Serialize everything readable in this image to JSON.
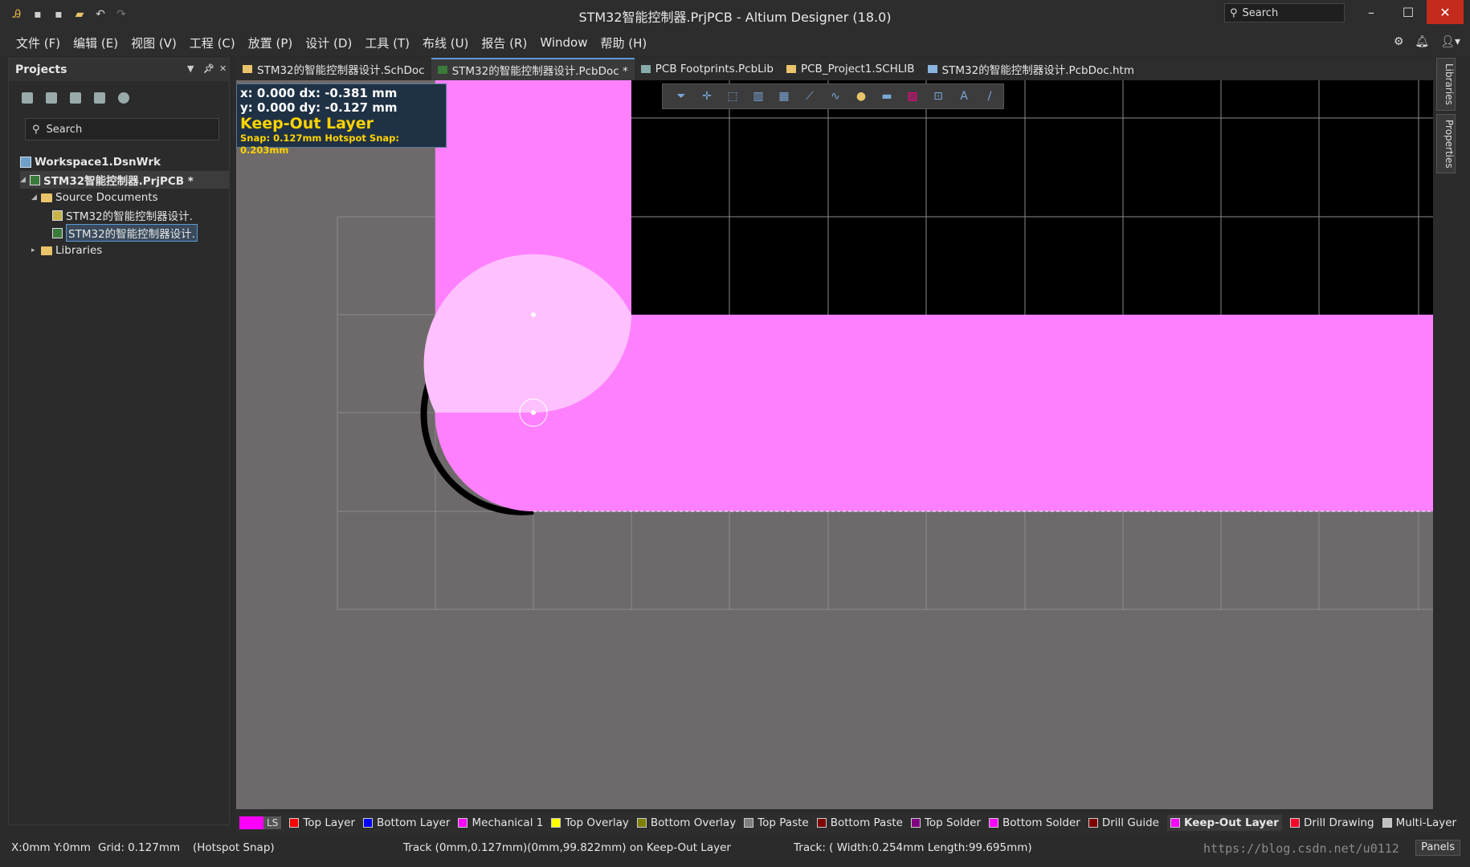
{
  "window": {
    "title": "STM32智能控制器.PrjPCB - Altium Designer (18.0)",
    "search_placeholder": "Search",
    "min": "–",
    "max": "☐",
    "close": "✕"
  },
  "menu": [
    "文件 (F)",
    "编辑 (E)",
    "视图 (V)",
    "工程 (C)",
    "放置 (P)",
    "设计 (D)",
    "工具 (T)",
    "布线 (U)",
    "报告 (R)",
    "Window",
    "帮助 (H)"
  ],
  "projects": {
    "title": "Projects",
    "search": "Search",
    "workspace": "Workspace1.DsnWrk",
    "project": "STM32智能控制器.PrjPCB *",
    "source_folder": "Source Documents",
    "doc1": "STM32的智能控制器设计.",
    "doc2": "STM32的智能控制器设计.",
    "libraries": "Libraries"
  },
  "tabs": [
    {
      "label": "STM32的智能控制器设计.SchDoc",
      "active": false
    },
    {
      "label": "STM32的智能控制器设计.PcbDoc *",
      "active": true
    },
    {
      "label": "PCB Footprints.PcbLib",
      "active": false
    },
    {
      "label": "PCB_Project1.SCHLIB",
      "active": false
    },
    {
      "label": "STM32的智能控制器设计.PcbDoc.htm",
      "active": false
    }
  ],
  "info": {
    "line1": "x:  0.000   dx: -0.381 mm",
    "line2": "y:  0.000   dy: -0.127 mm",
    "layer": "Keep-Out Layer",
    "snap": "Snap: 0.127mm Hotspot Snap: 0.203mm"
  },
  "dock": {
    "libraries": "Libraries",
    "properties": "Properties"
  },
  "layers": {
    "ls": "LS",
    "items": [
      {
        "label": "Top Layer",
        "color": "#ff0000"
      },
      {
        "label": "Bottom Layer",
        "color": "#0000ff"
      },
      {
        "label": "Mechanical 1",
        "color": "#ff00ff"
      },
      {
        "label": "Top Overlay",
        "color": "#ffff00"
      },
      {
        "label": "Bottom Overlay",
        "color": "#808000"
      },
      {
        "label": "Top Paste",
        "color": "#808080"
      },
      {
        "label": "Bottom Paste",
        "color": "#800000"
      },
      {
        "label": "Top Solder",
        "color": "#800080"
      },
      {
        "label": "Bottom Solder",
        "color": "#ff00ff"
      },
      {
        "label": "Drill Guide",
        "color": "#800000"
      },
      {
        "label": "Keep-Out Layer",
        "color": "#ff00ff"
      },
      {
        "label": "Drill Drawing",
        "color": "#ff002a"
      },
      {
        "label": "Multi-Layer",
        "color": "#c0c0c0"
      }
    ],
    "active": "Keep-Out Layer"
  },
  "status": {
    "coords": "X:0mm Y:0mm",
    "grid": "Grid: 0.127mm",
    "snap": "(Hotspot Snap)",
    "track": "Track (0mm,0.127mm)(0mm,99.822mm) on Keep-Out Layer",
    "track2": "Track: ( Width:0.254mm Length:99.695mm)",
    "panels": "Panels",
    "watermark": "https://blog.csdn.net/u0112"
  },
  "colors": {
    "keepout": "#ff80ff",
    "highlight": "#ffc0ff",
    "board_bg": "#6e6a6b"
  }
}
